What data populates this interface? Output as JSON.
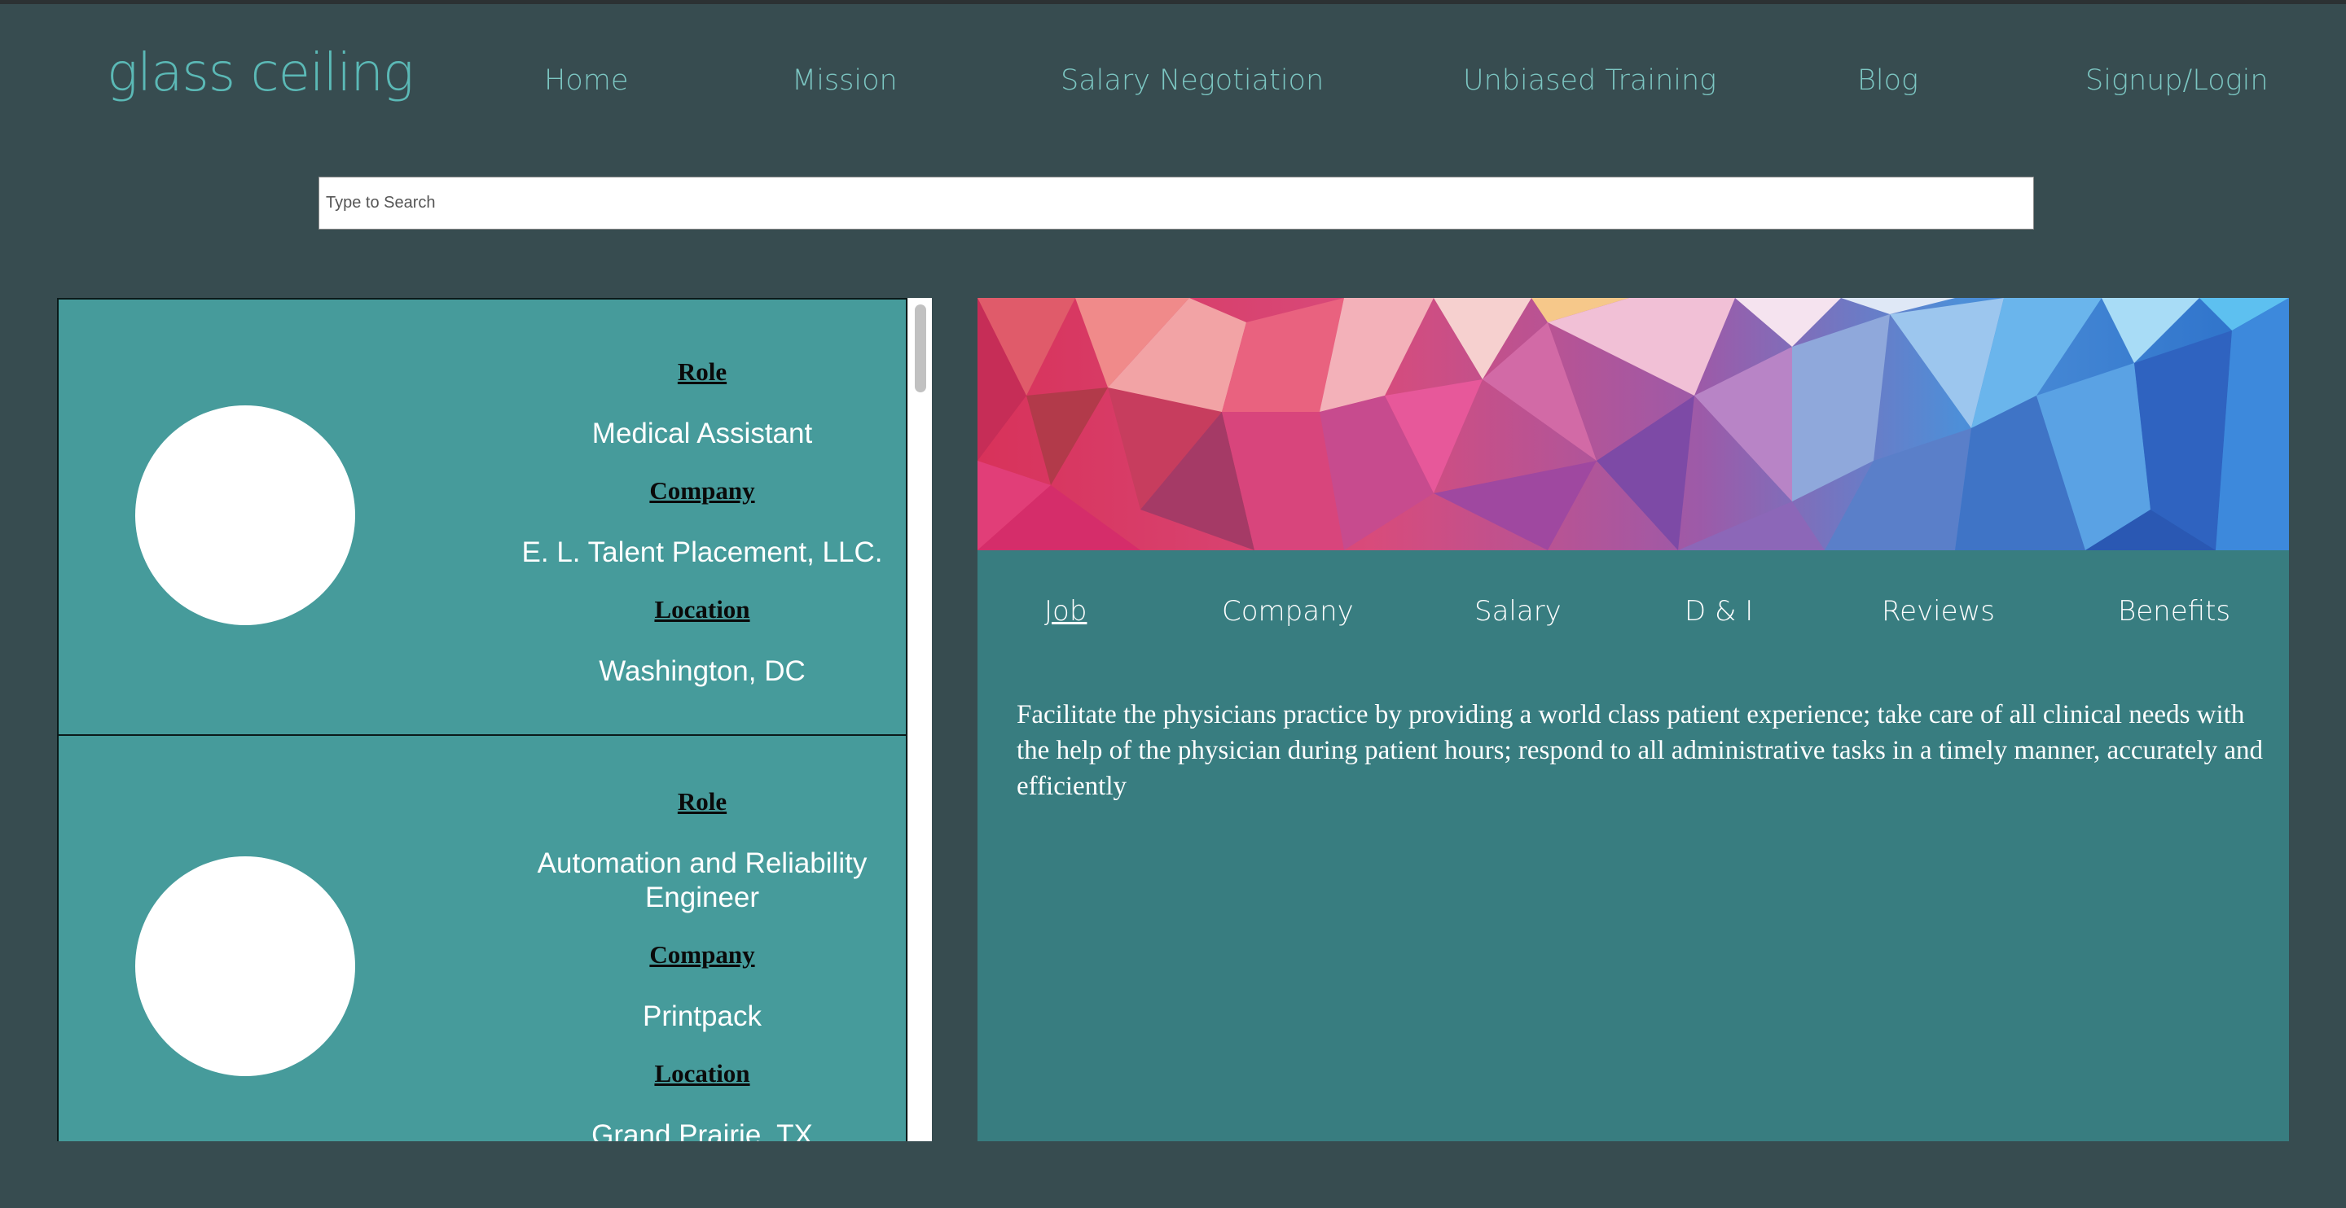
{
  "header": {
    "logo": "glass ceiling",
    "nav": [
      "Home",
      "Mission",
      "Salary Negotiation",
      "Unbiased Training",
      "Blog",
      "Signup/Login"
    ]
  },
  "search": {
    "placeholder": "Type to Search",
    "value": ""
  },
  "listings": [
    {
      "role_label": "Role",
      "role": "Medical Assistant",
      "company_label": "Company",
      "company": "E. L. Talent Placement, LLC.",
      "location_label": "Location",
      "location": "Washington, DC"
    },
    {
      "role_label": "Role",
      "role": "Automation and Reliability Engineer",
      "company_label": "Company",
      "company": "Printpack",
      "location_label": "Location",
      "location": "Grand Prairie, TX"
    }
  ],
  "detail": {
    "tabs": [
      "Job",
      "Company",
      "Salary",
      "D & I",
      "Reviews",
      "Benefits"
    ],
    "active_tab": "Job",
    "description": "Facilitate the physicians practice by providing a world class patient experience; take care of all clinical needs with the help of the physician during patient hours; respond to all administrative tasks in a timely manner, accurately and efficiently"
  },
  "colors": {
    "page_bg": "#374c50",
    "logo": "#5bb9b6",
    "nav_text": "#7cc6c2",
    "card_bg": "#469b9b",
    "detail_bg": "#387d80"
  }
}
